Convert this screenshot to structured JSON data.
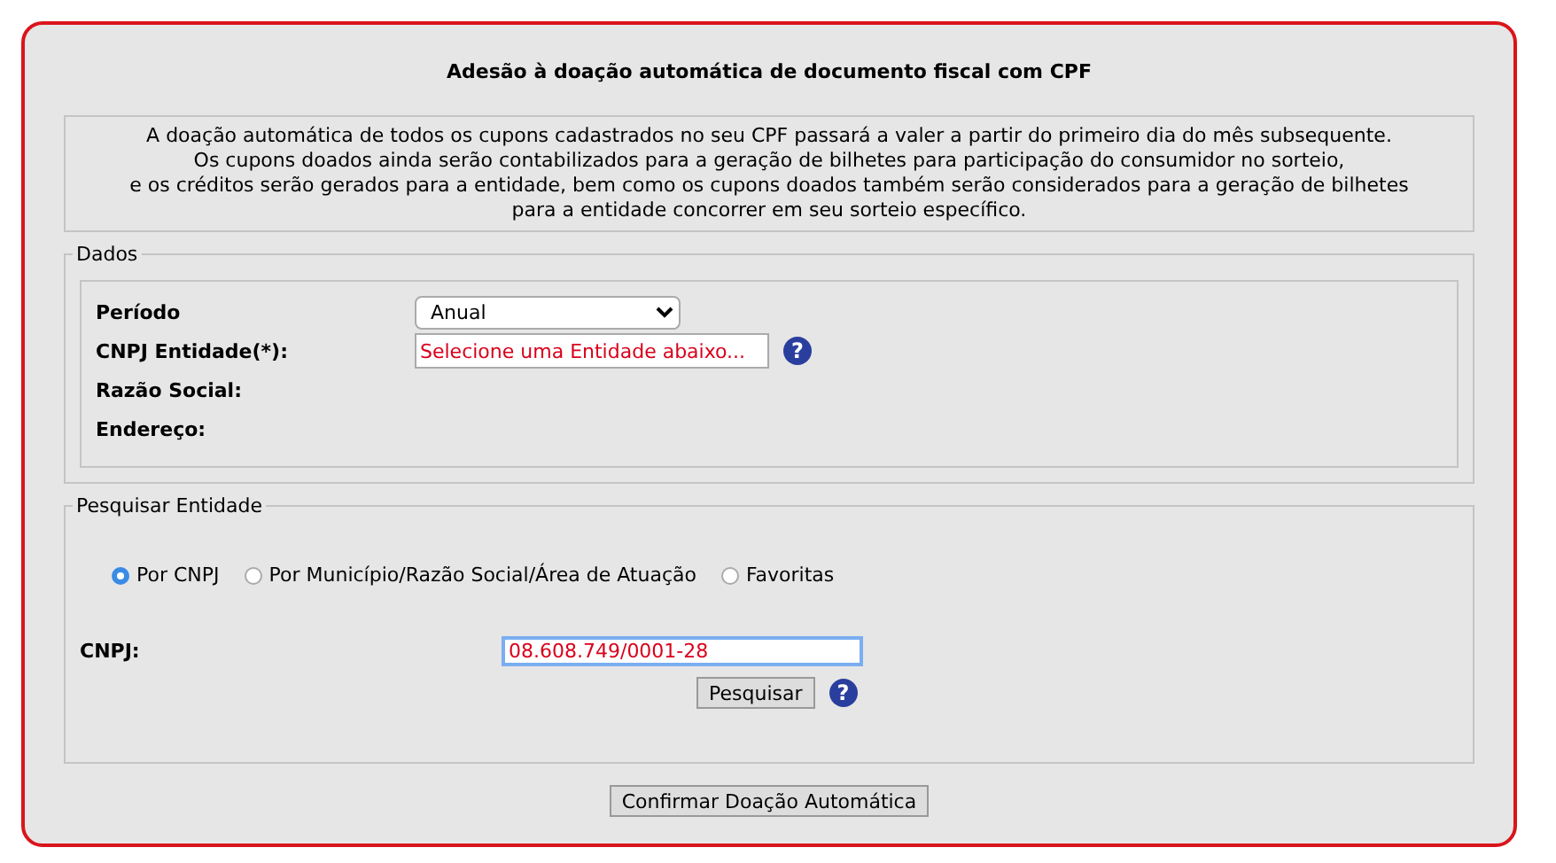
{
  "title": "Adesão à doação automática de documento fiscal com CPF",
  "notice": [
    "A doação automática de todos os cupons cadastrados no seu CPF passará a valer a partir do primeiro dia do mês subsequente.",
    "Os cupons doados ainda serão contabilizados para a geração de bilhetes para participação do consumidor no sorteio,",
    "e os créditos serão gerados para a entidade, bem como os cupons doados também serão considerados para a geração de bilhetes",
    "para a entidade concorrer em seu sorteio específico."
  ],
  "dados": {
    "legend": "Dados",
    "rows": [
      {
        "kind": "select",
        "label": "Período",
        "value": "Anual"
      },
      {
        "kind": "input",
        "label": "CNPJ Entidade(*):",
        "value": "Selecione uma Entidade abaixo...",
        "help": "?"
      },
      {
        "kind": "text",
        "label": "Razão Social:"
      },
      {
        "kind": "text",
        "label": "Endereço:"
      }
    ]
  },
  "pesquisar": {
    "legend": "Pesquisar Entidade",
    "options": [
      {
        "label": "Por CNPJ",
        "selected": true
      },
      {
        "label": "Por Município/Razão Social/Área de Atuação",
        "selected": false
      },
      {
        "label": "Favoritas",
        "selected": false
      }
    ],
    "cnpj_label": "CNPJ:",
    "cnpj_value": "08.608.749/0001-28",
    "button": "Pesquisar",
    "help": "?"
  },
  "confirm_button": "Confirmar Doação Automática"
}
